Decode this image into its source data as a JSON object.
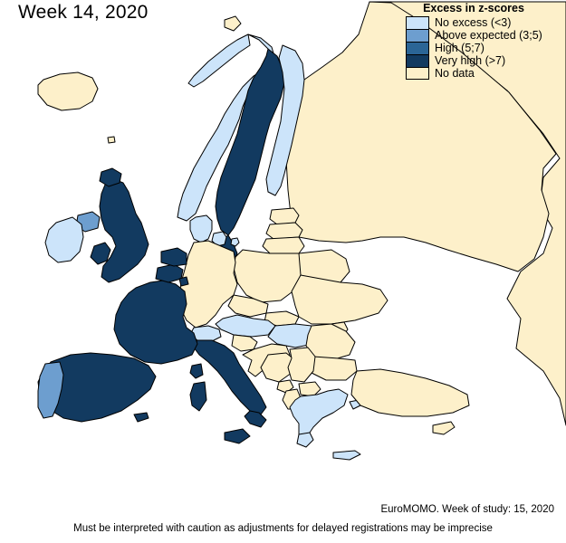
{
  "title": "Week 14, 2020",
  "legend": {
    "title": "Excess in z-scores",
    "items": [
      {
        "label": "No excess (<3)",
        "color": "#cce4fa",
        "key": "no_excess"
      },
      {
        "label": "Above expected (3;5)",
        "color": "#6d9ecf",
        "key": "above_expected"
      },
      {
        "label": "High (5;7)",
        "color": "#2b6596",
        "key": "high"
      },
      {
        "label": "Very high (>7)",
        "color": "#123a60",
        "key": "very_high"
      },
      {
        "label": "No data",
        "color": "#fdf0ca",
        "key": "no_data"
      }
    ]
  },
  "footer": {
    "source": "EuroMOMO. Week of study: 15, 2020",
    "caution": "Must be interpreted with caution as adjustments for delayed registrations may be imprecise"
  },
  "map": {
    "projection_note": "Europe, stereographic-like outline",
    "border_color": "#000000",
    "background": "#ffffff",
    "countries": [
      {
        "name": "Iceland",
        "category": "no_data"
      },
      {
        "name": "Norway",
        "category": "no_excess"
      },
      {
        "name": "Sweden",
        "category": "very_high"
      },
      {
        "name": "Finland",
        "category": "no_excess"
      },
      {
        "name": "Denmark",
        "category": "no_excess"
      },
      {
        "name": "Estonia",
        "category": "no_data"
      },
      {
        "name": "Latvia",
        "category": "no_data"
      },
      {
        "name": "Lithuania",
        "category": "no_data"
      },
      {
        "name": "Russia",
        "category": "no_data"
      },
      {
        "name": "Belarus",
        "category": "no_data"
      },
      {
        "name": "Ukraine",
        "category": "no_data"
      },
      {
        "name": "Poland",
        "category": "no_data"
      },
      {
        "name": "Germany",
        "category": "no_data"
      },
      {
        "name": "Netherlands",
        "category": "very_high"
      },
      {
        "name": "Belgium",
        "category": "very_high"
      },
      {
        "name": "Luxembourg",
        "category": "very_high"
      },
      {
        "name": "United Kingdom",
        "category": "very_high"
      },
      {
        "name": "Northern Ireland",
        "category": "above_expected"
      },
      {
        "name": "Ireland",
        "category": "no_excess"
      },
      {
        "name": "France",
        "category": "very_high"
      },
      {
        "name": "Switzerland",
        "category": "no_excess"
      },
      {
        "name": "Austria",
        "category": "no_excess"
      },
      {
        "name": "Czechia",
        "category": "no_data"
      },
      {
        "name": "Slovakia",
        "category": "no_data"
      },
      {
        "name": "Hungary",
        "category": "no_excess"
      },
      {
        "name": "Romania",
        "category": "no_data"
      },
      {
        "name": "Moldova",
        "category": "no_data"
      },
      {
        "name": "Bulgaria",
        "category": "no_data"
      },
      {
        "name": "Slovenia",
        "category": "no_data"
      },
      {
        "name": "Croatia",
        "category": "no_data"
      },
      {
        "name": "Bosnia and Herzegovina",
        "category": "no_data"
      },
      {
        "name": "Serbia",
        "category": "no_data"
      },
      {
        "name": "Montenegro",
        "category": "no_data"
      },
      {
        "name": "Albania",
        "category": "no_data"
      },
      {
        "name": "North Macedonia",
        "category": "no_data"
      },
      {
        "name": "Greece",
        "category": "no_excess"
      },
      {
        "name": "Italy",
        "category": "very_high"
      },
      {
        "name": "Spain",
        "category": "very_high"
      },
      {
        "name": "Portugal",
        "category": "above_expected"
      },
      {
        "name": "Turkey",
        "category": "no_data"
      },
      {
        "name": "Cyprus",
        "category": "no_data"
      }
    ]
  }
}
